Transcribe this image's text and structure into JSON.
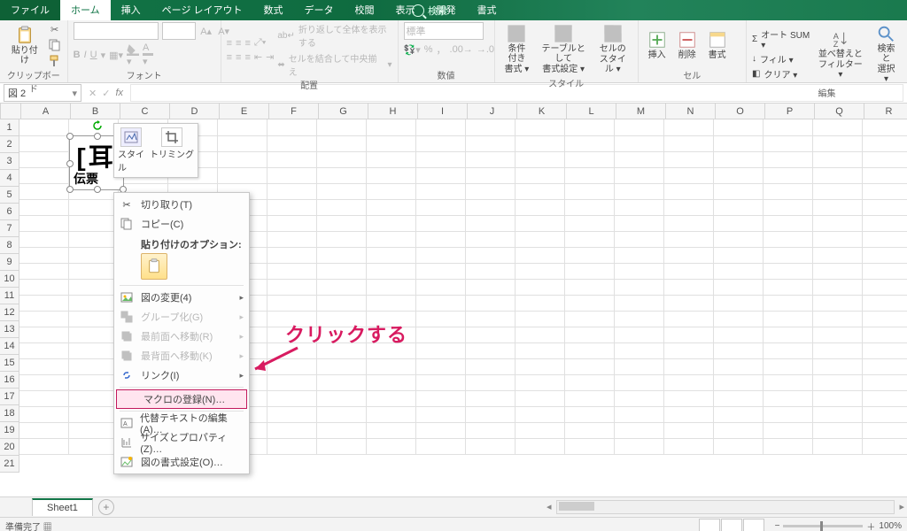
{
  "tabs": {
    "file": "ファイル",
    "home": "ホーム",
    "insert": "挿入",
    "layout": "ページ レイアウト",
    "formulas": "数式",
    "data": "データ",
    "review": "校閲",
    "view": "表示",
    "dev": "開発",
    "format": "書式"
  },
  "search_placeholder": "検索",
  "groups": {
    "clipboard": "クリップボード",
    "font": "フォント",
    "alignment": "配置",
    "number": "数値",
    "styles": "スタイル",
    "cells": "セル",
    "editing": "編集"
  },
  "ribbon": {
    "paste": "貼り付け",
    "wrap": "折り返して全体を表示する",
    "merge": "セルを結合して中央揃え",
    "number_format": "標準",
    "cond_fmt_l1": "条件付き",
    "cond_fmt_l2": "書式 ▾",
    "tbl_fmt_l1": "テーブルとして",
    "tbl_fmt_l2": "書式設定 ▾",
    "cell_style_l1": "セルの",
    "cell_style_l2": "スタイル ▾",
    "insert": "挿入",
    "delete": "削除",
    "format": "書式",
    "autosum": "オート SUM ▾",
    "fill": "フィル ▾",
    "clear": "クリア ▾",
    "sort_l1": "並べ替えと",
    "sort_l2": "フィルター ▾",
    "find_l1": "検索と",
    "find_l2": "選択 ▾"
  },
  "namebox": "図 2",
  "fx": "fx",
  "columns": [
    "A",
    "B",
    "C",
    "D",
    "E",
    "F",
    "G",
    "H",
    "I",
    "J",
    "K",
    "L",
    "M",
    "N",
    "O",
    "P",
    "Q",
    "R"
  ],
  "rows": [
    "1",
    "2",
    "3",
    "4",
    "5",
    "6",
    "7",
    "8",
    "9",
    "10",
    "11",
    "12",
    "13",
    "14",
    "15",
    "16",
    "17",
    "18",
    "19",
    "20",
    "21"
  ],
  "pic": {
    "glyph": "[耳",
    "caption": "伝票"
  },
  "mini": {
    "style": "スタイ\nル",
    "crop": "トリミング"
  },
  "ctx": {
    "cut": "切り取り(T)",
    "copy": "コピー(C)",
    "paste_hdr": "貼り付けのオプション:",
    "change": "図の変更(4)",
    "group": "グループ化(G)",
    "bringfront": "最前面へ移動(R)",
    "sendback": "最背面へ移動(K)",
    "link": "リンク(I)",
    "assign": "マクロの登録(N)…",
    "alttext": "代替テキストの編集(A)…",
    "sizeprops": "サイズとプロパティ(Z)…",
    "formatpic": "図の書式設定(O)…"
  },
  "annotation": "クリックする",
  "sheet_tab": "Sheet1",
  "status": "準備完了",
  "zoom": "100%"
}
